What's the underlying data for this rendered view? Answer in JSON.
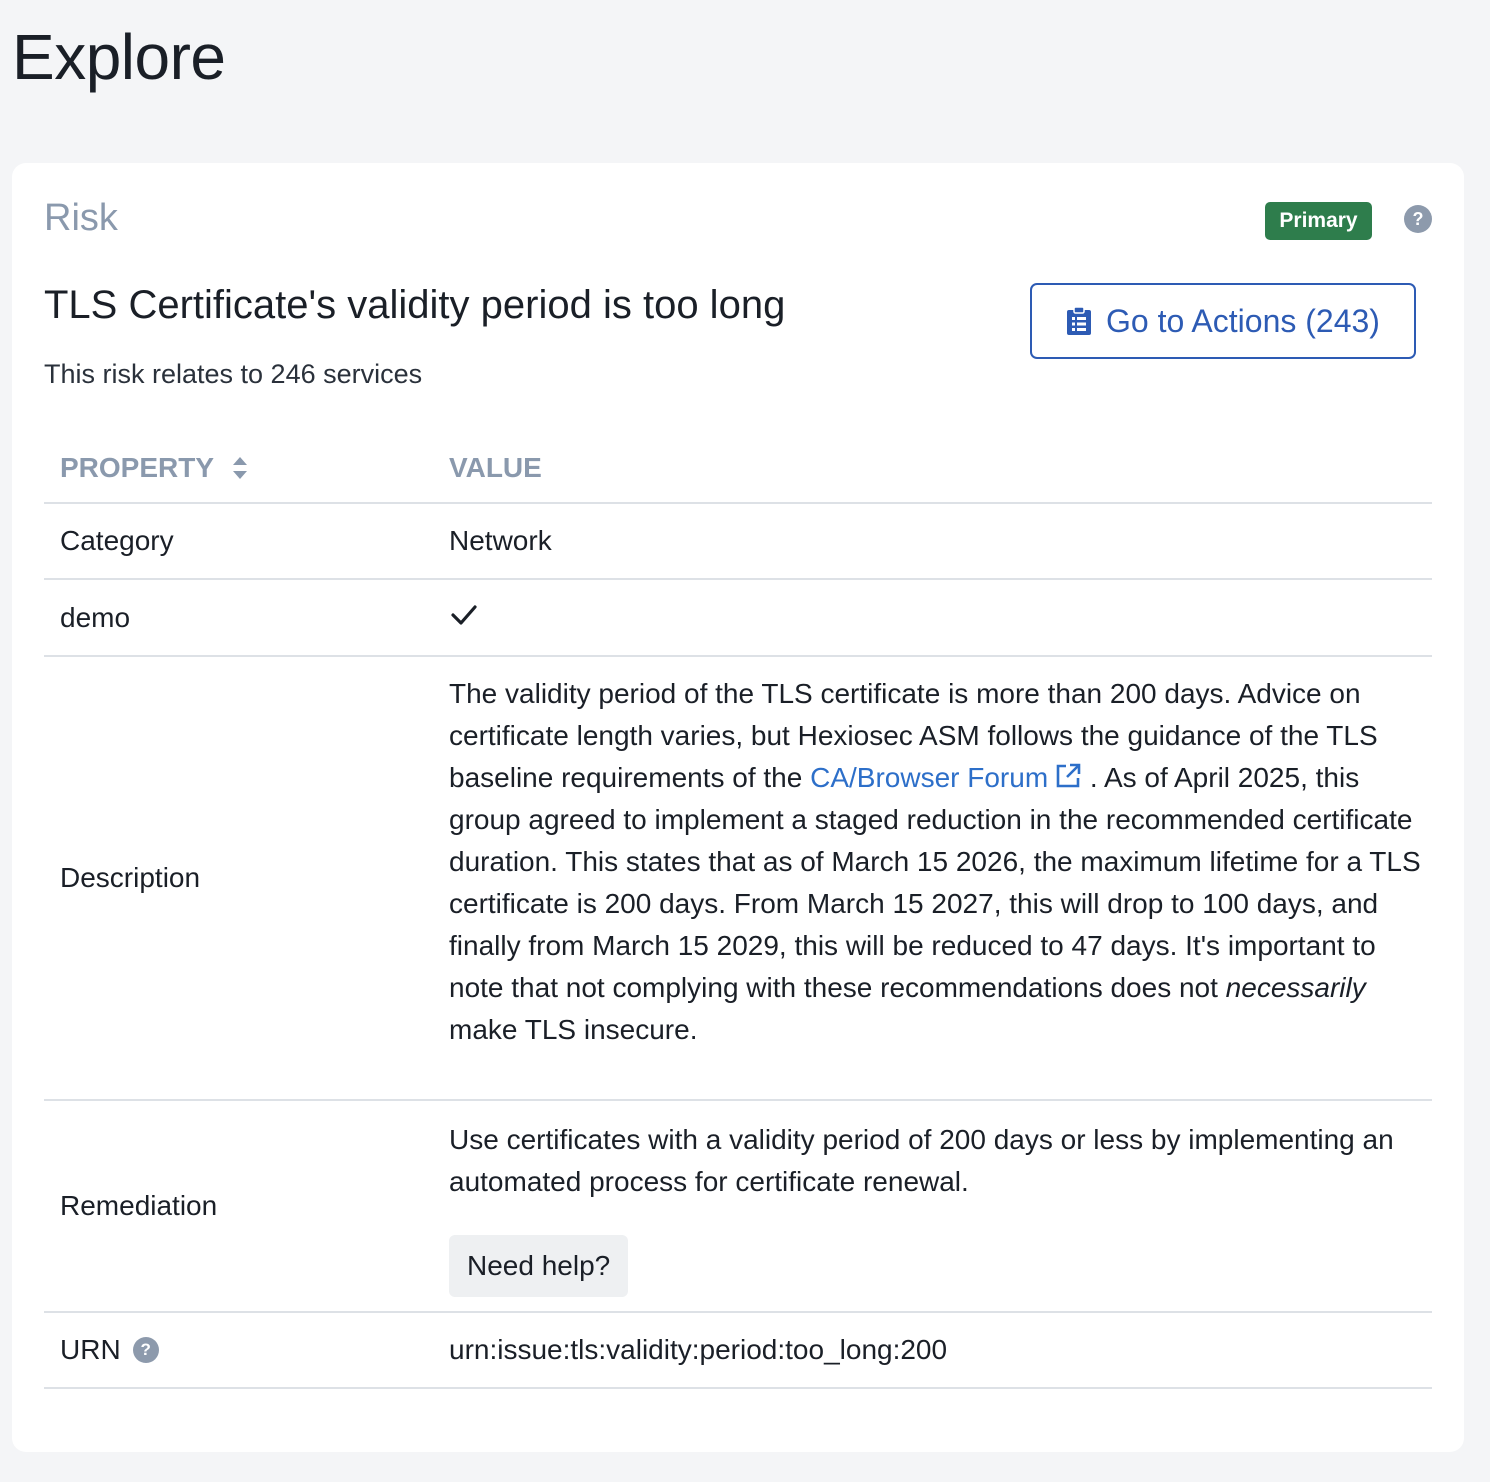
{
  "page": {
    "title": "Explore"
  },
  "card": {
    "section_title": "Risk",
    "badge": "Primary",
    "help_symbol": "?",
    "risk_title": "TLS Certificate's validity period is too long",
    "risk_subtitle": "This risk relates to 246 services",
    "actions_button": "Go to Actions (243)"
  },
  "table": {
    "headers": {
      "property": "PROPERTY",
      "value": "VALUE"
    },
    "category": {
      "label": "Category",
      "value": "Network"
    },
    "demo": {
      "label": "demo",
      "value_icon": "checkmark-icon"
    },
    "description": {
      "label": "Description",
      "text_1": "The validity period of the TLS certificate is more than 200 days. Advice on certificate length varies, but Hexiosec ASM follows the guidance of the TLS baseline requirements of the ",
      "link": "CA/Browser Forum",
      "text_2": " . As of April 2025, this group agreed to implement a staged reduction in the recommended certificate duration. This states that as of March 15 2026, the maximum lifetime for a TLS certificate is 200 days. From March 15 2027, this will drop to 100 days, and finally from March 15 2029, this will be reduced to 47 days. It's important to note that not complying with these recommendations does not ",
      "emphasis": "necessarily",
      "text_3": " make TLS insecure."
    },
    "remediation": {
      "label": "Remediation",
      "text": "Use certificates with a validity period of 200 days or less by implementing an automated process for certificate renewal.",
      "help_button": "Need help?"
    },
    "urn": {
      "label": "URN",
      "help_symbol": "?",
      "value": "urn:issue:tls:validity:period:too_long:200"
    }
  },
  "colors": {
    "page_bg": "#f4f5f7",
    "accent": "#2d5bb4",
    "link": "#2d6fc9",
    "badge_green": "#2e7d4c",
    "muted": "#8a99ad"
  }
}
